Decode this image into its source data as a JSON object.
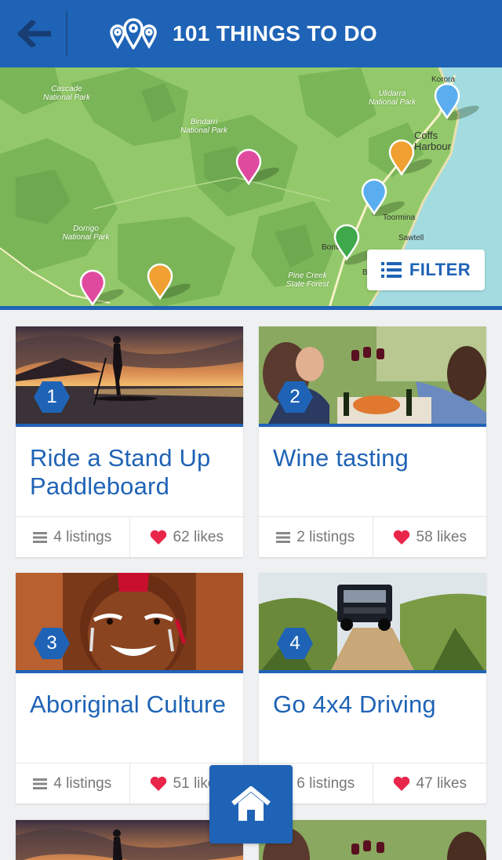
{
  "header": {
    "title": "101 THINGS TO DO",
    "accent_color": "#1f63b6"
  },
  "map": {
    "labels": [
      {
        "text": "Cascade\nNational Park"
      },
      {
        "text": "Bindarri\nNational Park"
      },
      {
        "text": "Dorrigo\nNational Park"
      },
      {
        "text": "Ulidarra\nNational Park"
      },
      {
        "text": "Pine Creek\nState Forest"
      }
    ],
    "towns": [
      {
        "text": "Korora"
      },
      {
        "text": "Coffs\nHarbour"
      },
      {
        "text": "Toormina"
      },
      {
        "text": "Sawtell"
      },
      {
        "text": "Bonv"
      },
      {
        "text": "B"
      }
    ],
    "pins": [
      {
        "color": "#5aaef0"
      },
      {
        "color": "#f0a030"
      },
      {
        "color": "#5aaef0"
      },
      {
        "color": "#3ea84a"
      },
      {
        "color": "#e04a9e"
      },
      {
        "color": "#e04a9e"
      },
      {
        "color": "#f0a030"
      }
    ],
    "filter_label": "FILTER"
  },
  "cards": [
    {
      "number": "1",
      "title": "Ride a Stand Up Paddleboard",
      "listings": "4 listings",
      "likes": "62 likes",
      "image": "sunset-paddleboard"
    },
    {
      "number": "2",
      "title": "Wine tasting",
      "listings": "2 listings",
      "likes": "58 likes",
      "image": "wine-toast"
    },
    {
      "number": "3",
      "title": "Aboriginal Culture",
      "listings": "4 listings",
      "likes": "51 likes",
      "image": "face-paint"
    },
    {
      "number": "4",
      "title": "Go 4x4 Driving",
      "listings": "6 listings",
      "likes": "47 likes",
      "image": "4x4-track"
    }
  ],
  "icons": {
    "back": "arrow-left-icon",
    "logo": "map-pins-icon",
    "filter": "list-icon",
    "listings": "menu-lines-icon",
    "likes": "heart-icon",
    "home": "home-icon"
  },
  "colors": {
    "heart": "#e8264a",
    "title_text": "#1f63b6"
  }
}
